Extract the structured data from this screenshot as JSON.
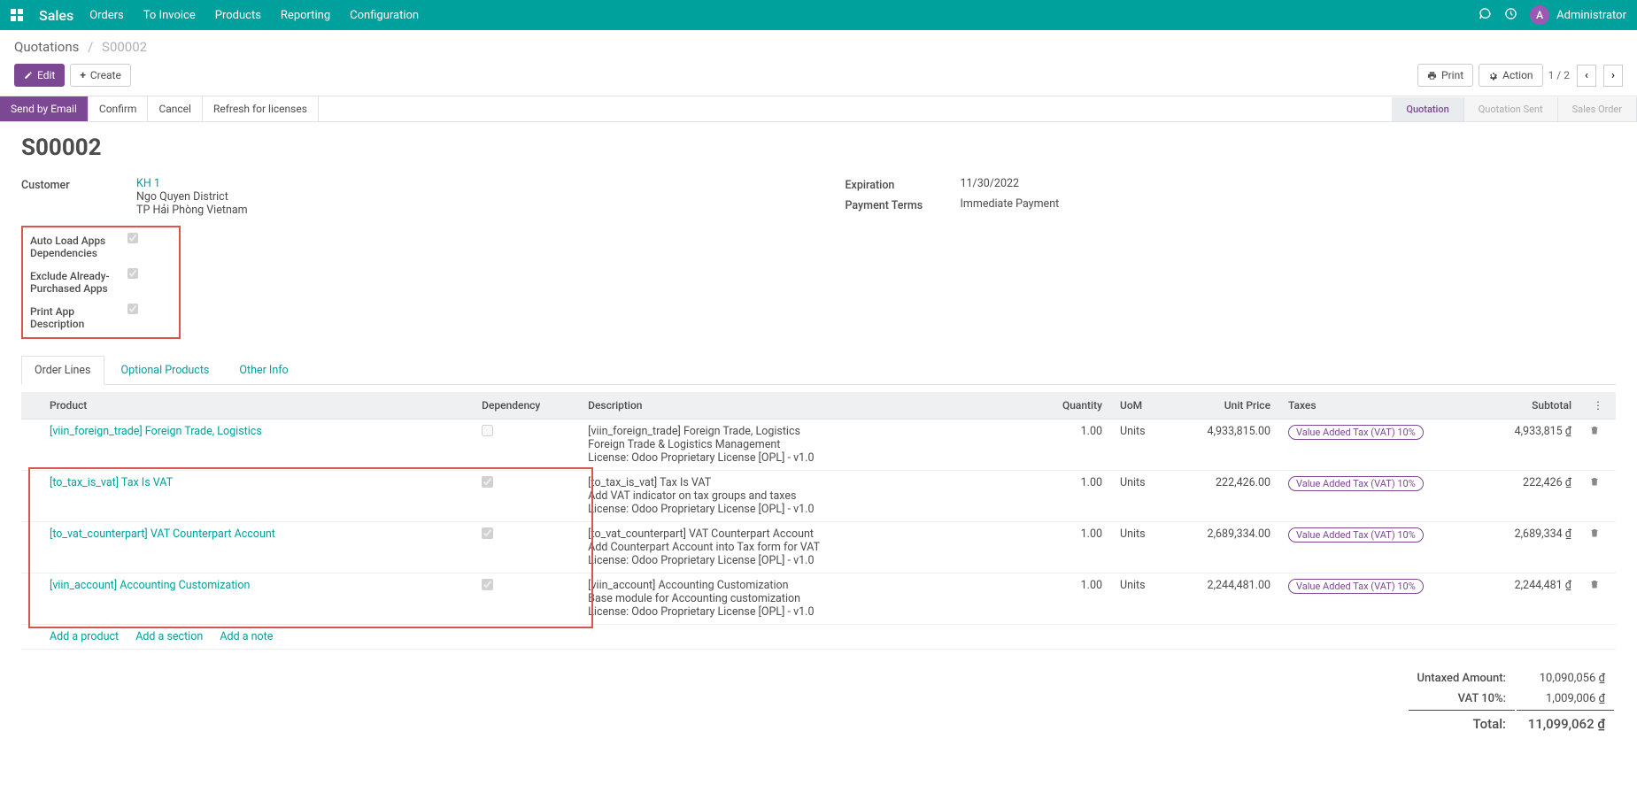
{
  "nav": {
    "brand": "Sales",
    "items": [
      "Orders",
      "To Invoice",
      "Products",
      "Reporting",
      "Configuration"
    ],
    "user": "Administrator",
    "avatar_letter": "A"
  },
  "breadcrumb": {
    "parent": "Quotations",
    "current": "S00002"
  },
  "toolbar": {
    "edit": "Edit",
    "create": "Create",
    "print": "Print",
    "action": "Action",
    "pager": "1 / 2"
  },
  "statusbar": {
    "buttons": [
      "Send by Email",
      "Confirm",
      "Cancel",
      "Refresh for licenses"
    ],
    "statuses": [
      "Quotation",
      "Quotation Sent",
      "Sales Order"
    ]
  },
  "title": "S00002",
  "fields": {
    "customer_label": "Customer",
    "customer_name": "KH 1",
    "customer_address1": "Ngo Quyen District",
    "customer_address2": "TP Hải Phòng Vietnam",
    "expiration_label": "Expiration",
    "expiration_value": "11/30/2022",
    "payment_terms_label": "Payment Terms",
    "payment_terms_value": "Immediate Payment",
    "autoload_label": "Auto Load Apps Dependencies",
    "exclude_label": "Exclude Already-Purchased Apps",
    "printdesc_label": "Print App Description"
  },
  "tabs": [
    "Order Lines",
    "Optional Products",
    "Other Info"
  ],
  "table": {
    "headers": {
      "product": "Product",
      "dependency": "Dependency",
      "description": "Description",
      "quantity": "Quantity",
      "uom": "UoM",
      "unitprice": "Unit Price",
      "taxes": "Taxes",
      "subtotal": "Subtotal"
    },
    "rows": [
      {
        "product": "[viin_foreign_trade] Foreign Trade, Logistics",
        "dependency_checked": false,
        "desc1": "[viin_foreign_trade] Foreign Trade, Logistics",
        "desc2": "Foreign Trade & Logistics Management",
        "desc3": "License: Odoo Proprietary License [OPL] - v1.0",
        "quantity": "1.00",
        "uom": "Units",
        "unitprice": "4,933,815.00",
        "tax": "Value Added Tax (VAT) 10%",
        "subtotal": "4,933,815 ₫"
      },
      {
        "product": "[to_tax_is_vat] Tax Is VAT",
        "dependency_checked": true,
        "desc1": "[to_tax_is_vat] Tax Is VAT",
        "desc2": "Add VAT indicator on tax groups and taxes",
        "desc3": "License: Odoo Proprietary License [OPL] - v1.0",
        "quantity": "1.00",
        "uom": "Units",
        "unitprice": "222,426.00",
        "tax": "Value Added Tax (VAT) 10%",
        "subtotal": "222,426 ₫"
      },
      {
        "product": "[to_vat_counterpart] VAT Counterpart Account",
        "dependency_checked": true,
        "desc1": "[to_vat_counterpart] VAT Counterpart Account",
        "desc2": "Add Counterpart Account into Tax form for VAT",
        "desc3": "License: Odoo Proprietary License [OPL] - v1.0",
        "quantity": "1.00",
        "uom": "Units",
        "unitprice": "2,689,334.00",
        "tax": "Value Added Tax (VAT) 10%",
        "subtotal": "2,689,334 ₫"
      },
      {
        "product": "[viin_account] Accounting Customization",
        "dependency_checked": true,
        "desc1": "[viin_account] Accounting Customization",
        "desc2": "Base module for Accounting customization",
        "desc3": "License: Odoo Proprietary License [OPL] - v1.0",
        "quantity": "1.00",
        "uom": "Units",
        "unitprice": "2,244,481.00",
        "tax": "Value Added Tax (VAT) 10%",
        "subtotal": "2,244,481 ₫"
      }
    ],
    "add_product": "Add a product",
    "add_section": "Add a section",
    "add_note": "Add a note"
  },
  "totals": {
    "untaxed_label": "Untaxed Amount:",
    "untaxed_value": "10,090,056 ₫",
    "vat_label": "VAT 10%:",
    "vat_value": "1,009,006 ₫",
    "total_label": "Total:",
    "total_value": "11,099,062 ₫"
  }
}
